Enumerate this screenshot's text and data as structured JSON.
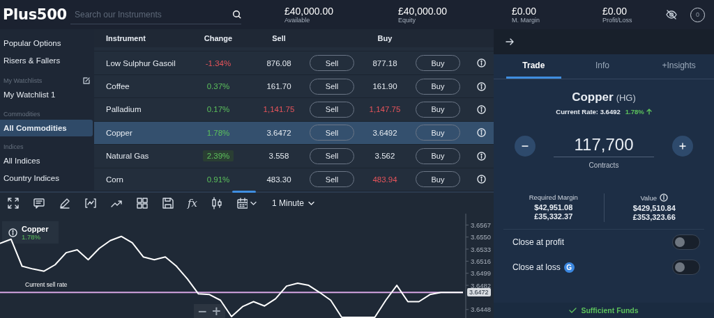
{
  "header": {
    "logo": "Plus500",
    "search": {
      "placeholder": "Search our Instruments"
    },
    "stats": [
      {
        "value": "£40,000.00",
        "label": "Available"
      },
      {
        "value": "£40,000.00",
        "label": "Equity"
      },
      {
        "value": "£0.00",
        "label": "M. Margin"
      },
      {
        "value": "£0.00",
        "label": "Profit/Loss"
      }
    ],
    "notifications": "0"
  },
  "sidebar": {
    "items": [
      {
        "kind": "item",
        "label": "Popular Options",
        "selected": false
      },
      {
        "kind": "item",
        "label": "Risers & Fallers",
        "selected": false
      },
      {
        "kind": "heading",
        "label": "My Watchlists",
        "editable": true
      },
      {
        "kind": "item",
        "label": "My Watchlist 1",
        "selected": false
      },
      {
        "kind": "heading",
        "label": "Commodities",
        "editable": false
      },
      {
        "kind": "item",
        "label": "All Commodities",
        "selected": true
      },
      {
        "kind": "heading",
        "label": "Indices",
        "editable": false
      },
      {
        "kind": "item",
        "label": "All Indices",
        "selected": false
      },
      {
        "kind": "item",
        "label": "Country Indices",
        "selected": false
      }
    ]
  },
  "table": {
    "columns": [
      "Instrument",
      "Change",
      "Sell",
      "Buy"
    ],
    "rows": [
      {
        "instrument": "Low Sulphur Gasoil",
        "change": "-1.34%",
        "change_down": true,
        "flash": false,
        "sell": "876.08",
        "sell_down": false,
        "sell_button": "Sell",
        "buy": "877.18",
        "buy_down": false,
        "buy_button": "Buy",
        "selected": false
      },
      {
        "instrument": "Coffee",
        "change": "0.37%",
        "change_down": false,
        "flash": false,
        "sell": "161.70",
        "sell_down": false,
        "sell_button": "Sell",
        "buy": "161.90",
        "buy_down": false,
        "buy_button": "Buy",
        "selected": false
      },
      {
        "instrument": "Palladium",
        "change": "0.17%",
        "change_down": false,
        "flash": false,
        "sell": "1,141.75",
        "sell_down": true,
        "sell_button": "Sell",
        "buy": "1,147.75",
        "buy_down": true,
        "buy_button": "Buy",
        "selected": false
      },
      {
        "instrument": "Copper",
        "change": "1.78%",
        "change_down": false,
        "flash": false,
        "sell": "3.6472",
        "sell_down": false,
        "sell_button": "Sell",
        "buy": "3.6492",
        "buy_down": false,
        "buy_button": "Buy",
        "selected": true
      },
      {
        "instrument": "Natural Gas",
        "change": "2.39%",
        "change_down": false,
        "flash": true,
        "sell": "3.558",
        "sell_down": false,
        "sell_button": "Sell",
        "buy": "3.562",
        "buy_down": false,
        "buy_button": "Buy",
        "selected": false
      },
      {
        "instrument": "Corn",
        "change": "0.91%",
        "change_down": false,
        "flash": false,
        "sell": "483.30",
        "sell_down": false,
        "sell_button": "Sell",
        "buy": "483.94",
        "buy_down": true,
        "buy_button": "Buy",
        "selected": false
      }
    ]
  },
  "chart": {
    "toolbar": {
      "function_label": "fx",
      "timeframe": "1 Minute"
    },
    "legend": {
      "change": "1.78%"
    },
    "zoom_controls": [
      "−",
      "+"
    ],
    "chart_data": {
      "type": "line",
      "ylim": [
        3.6436,
        3.6583
      ],
      "yticks": [
        3.6567,
        {
          "value": 3.655,
          "label": "3.6550"
        },
        3.6533,
        3.6516,
        3.6499,
        3.6482,
        3.6448
      ],
      "series": [
        {
          "name": "Copper",
          "color": "#ffffff",
          "values": [
            3.6541,
            3.6547,
            3.6509,
            3.6505,
            3.6502,
            3.6511,
            3.6528,
            3.6532,
            3.6518,
            3.6534,
            3.6545,
            3.6551,
            3.6542,
            3.6522,
            3.6518,
            3.6522,
            3.6509,
            3.6491,
            3.647,
            3.6469,
            3.6461,
            3.6438,
            3.6452,
            3.6459,
            3.6453,
            3.6463,
            3.6481,
            3.6485,
            3.6482,
            3.6472,
            3.6461,
            3.6437,
            3.6437,
            3.6437,
            3.6437,
            3.6461,
            3.6482,
            3.6459,
            3.6459,
            3.6469,
            3.6472,
            3.6472,
            3.6472
          ]
        }
      ],
      "ref_lines": [
        {
          "axis": "y",
          "value": 3.6472,
          "label": "Current sell rate",
          "color": "#d7a6e4"
        }
      ],
      "annotations": [
        "3.6472"
      ]
    }
  },
  "trade_panel": {
    "tabs": [
      {
        "label": "Trade",
        "selected": true
      },
      {
        "label": "Info",
        "selected": false
      },
      {
        "label": "+Insights",
        "selected": false
      }
    ],
    "instrument": "Copper",
    "symbol": "(HG)",
    "rate": "Current Rate: 3.6492",
    "rate_change": "1.78%",
    "rate_up": true,
    "amount": "117,700",
    "unit": "Contracts",
    "figures": [
      {
        "label": "Required Margin",
        "info": false,
        "values": [
          "$42,951.08",
          "£35,332.37"
        ]
      },
      {
        "label": "Value",
        "info": true,
        "values": [
          "$429,510.84",
          "£353,323.66"
        ]
      }
    ],
    "toggles": [
      {
        "label": "Close at profit",
        "on": false
      },
      {
        "label": "Close at loss",
        "badge": "G",
        "on": false
      }
    ],
    "status": "Sufficient Funds"
  }
}
